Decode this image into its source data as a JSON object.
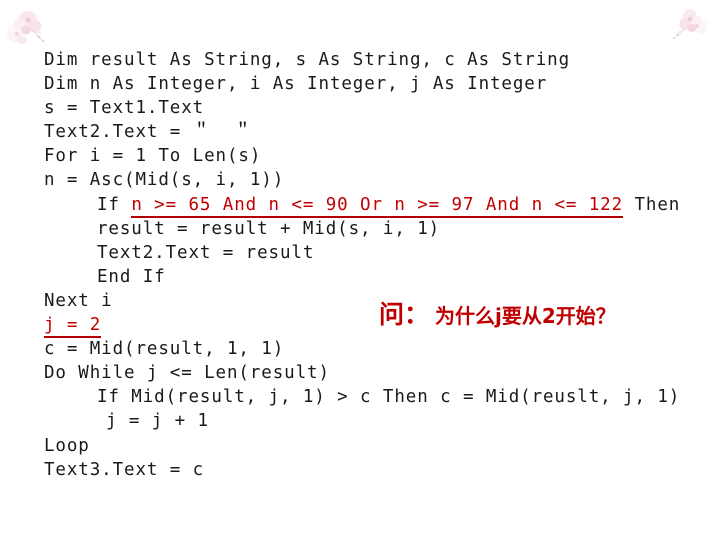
{
  "slide": {
    "background_color": "#ffffff",
    "code_color": "#1a1a1a",
    "highlight_color": "#c00000",
    "decorations": [
      {
        "name": "floral-decoration-top-left",
        "position": "top-left"
      },
      {
        "name": "floral-decoration-top-right",
        "position": "top-right"
      }
    ]
  },
  "code": {
    "lines": [
      {
        "indent": 0,
        "text": "Dim result As String, s As String, c As String"
      },
      {
        "indent": 0,
        "text": "Dim n As Integer, i As Integer, j As Integer"
      },
      {
        "indent": 0,
        "text": "s = Text1.Text"
      },
      {
        "indent": 0,
        "text": "Text2.Text = ＂  ＂"
      },
      {
        "indent": 0,
        "text": "For i = 1 To Len(s)"
      },
      {
        "indent": 0,
        "text": "n = Asc(Mid(s, i, 1))"
      },
      {
        "indent": 1,
        "prefix": "If ",
        "highlight": "n >= 65 And n <= 90 Or n >= 97 And n <= 122",
        "suffix": " Then"
      },
      {
        "indent": 1,
        "text": "result = result + Mid(s, i, 1)"
      },
      {
        "indent": 1,
        "text": "Text2.Text = result"
      },
      {
        "indent": 1,
        "text": "End If"
      },
      {
        "indent": 0,
        "text": "Next i"
      },
      {
        "indent": 0,
        "highlight_full": "j = 2"
      },
      {
        "indent": 0,
        "text": "c = Mid(result, 1, 1)"
      },
      {
        "indent": 0,
        "text": "Do While j <= Len(result)"
      },
      {
        "indent": 1,
        "text": "If Mid(result, j, 1) > c Then c = Mid(reuslt, j, 1)"
      },
      {
        "indent": 2,
        "text": "j = j + 1"
      },
      {
        "indent": 0,
        "text": "Loop"
      },
      {
        "indent": 0,
        "text": "Text3.Text = c"
      }
    ]
  },
  "annotation": {
    "label": "问：",
    "question": "为什么j要从2开始？"
  }
}
